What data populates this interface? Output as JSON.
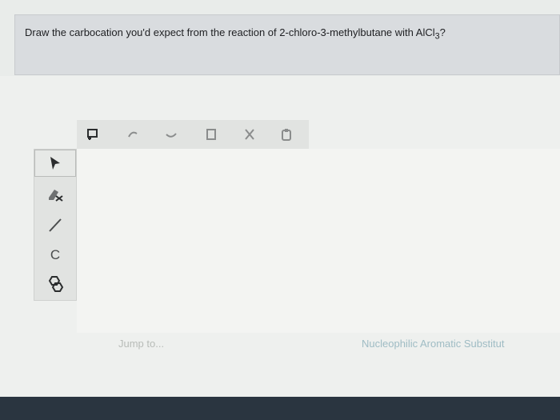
{
  "question": {
    "text": "Draw the carbocation you'd expect from the reaction of 2-chloro-3-methylbutane with AlCl",
    "subscript": "3",
    "suffix": "?"
  },
  "editor": {
    "top_tools": [
      "new-icon",
      "undo-icon",
      "redo-icon",
      "copy-icon",
      "cut-icon",
      "paste-icon"
    ],
    "side_tools": [
      "select-arrow-icon",
      "eraser-icon",
      "bond-icon",
      "carbon-tool",
      "ring-icon"
    ],
    "carbon_label": "C"
  },
  "footer": {
    "jump_to": "Jump to...",
    "next": "Nucleophilic Aromatic Substitut"
  }
}
